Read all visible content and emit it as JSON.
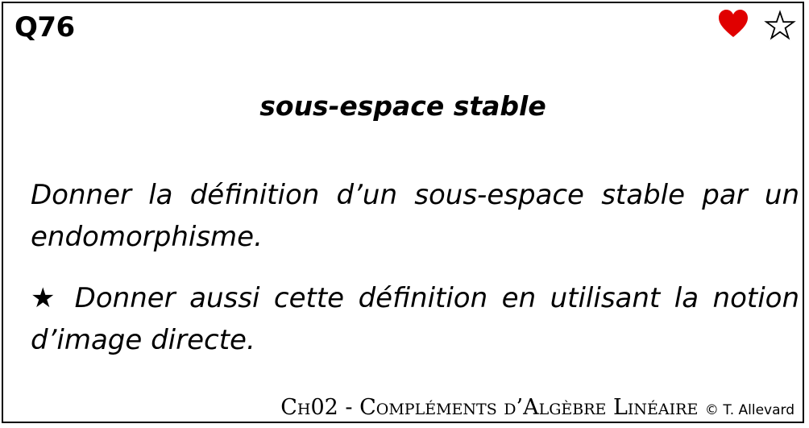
{
  "card": {
    "number": "Q76",
    "subject": "sous-espace stable",
    "question": "Donner la définition d’un sous-espace stable par un endomorphisme.",
    "bonus_marker": "★",
    "bonus_question": "Donner aussi cette définition en utilisant la notion d’image directe.",
    "footer": {
      "chapter": "Ch02 - Compléments d’Algèbre Linéaire",
      "copyright": "© T. Allevard"
    }
  },
  "icons": {
    "favorite": "heart-icon",
    "difficulty": "star-outline-icon",
    "favorite_color": "#e00000"
  }
}
